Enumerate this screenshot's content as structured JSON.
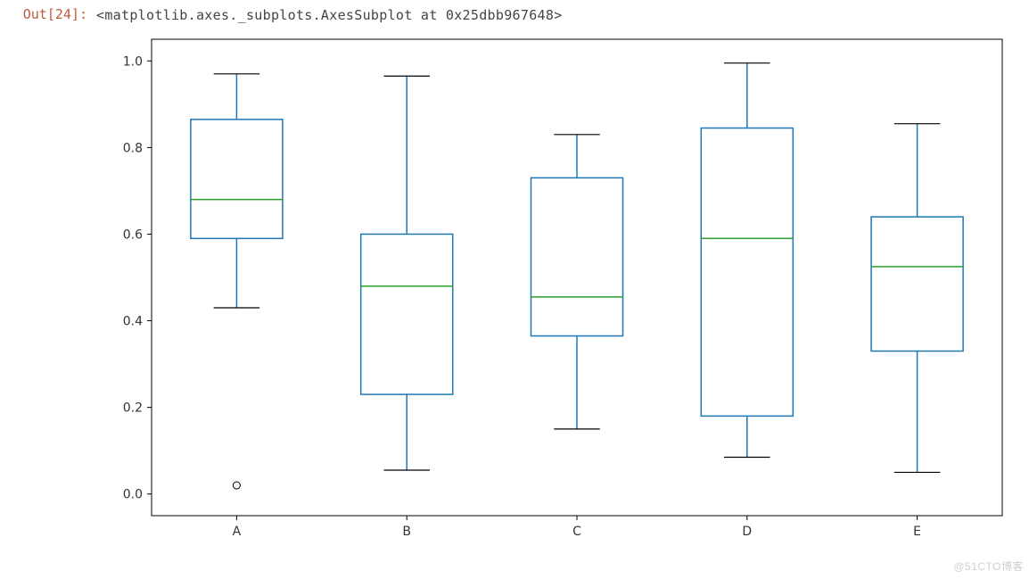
{
  "prompt": "Out[24]:",
  "repr": "<matplotlib.axes._subplots.AxesSubplot at 0x25dbb967648>",
  "watermark": "@51CTO博客",
  "chart_data": {
    "type": "boxplot",
    "categories": [
      "A",
      "B",
      "C",
      "D",
      "E"
    ],
    "xlabel": "",
    "ylabel": "",
    "ylim": [
      -0.05,
      1.05
    ],
    "y_ticks": [
      0.0,
      0.2,
      0.4,
      0.6,
      0.8,
      1.0
    ],
    "y_tick_labels": [
      "0.0",
      "0.2",
      "0.4",
      "0.6",
      "0.8",
      "1.0"
    ],
    "boxes": [
      {
        "label": "A",
        "whisker_low": 0.43,
        "q1": 0.59,
        "median": 0.68,
        "q3": 0.865,
        "whisker_high": 0.97,
        "fliers": [
          0.02
        ]
      },
      {
        "label": "B",
        "whisker_low": 0.055,
        "q1": 0.23,
        "median": 0.48,
        "q3": 0.6,
        "whisker_high": 0.965,
        "fliers": []
      },
      {
        "label": "C",
        "whisker_low": 0.15,
        "q1": 0.365,
        "median": 0.455,
        "q3": 0.73,
        "whisker_high": 0.83,
        "fliers": []
      },
      {
        "label": "D",
        "whisker_low": 0.085,
        "q1": 0.18,
        "median": 0.59,
        "q3": 0.845,
        "whisker_high": 0.995,
        "fliers": []
      },
      {
        "label": "E",
        "whisker_low": 0.05,
        "q1": 0.33,
        "median": 0.525,
        "q3": 0.64,
        "whisker_high": 0.855,
        "fliers": []
      }
    ],
    "colors": {
      "box_edge": "#1f77b4",
      "whisker": "#1f77b4",
      "median": "#2ca02c",
      "cap": "#000000",
      "flier_edge": "#000000"
    }
  }
}
